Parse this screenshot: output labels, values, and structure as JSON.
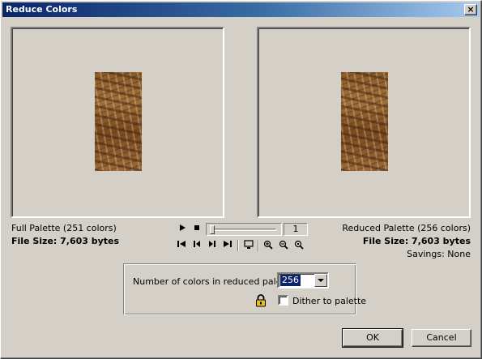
{
  "window": {
    "title": "Reduce Colors",
    "close_glyph": "×"
  },
  "left_panel": {
    "label": "Full Palette  (251 colors)",
    "file_size": "File Size:  7,603 bytes"
  },
  "right_panel": {
    "label": "Reduced Palette (256 colors)",
    "file_size": "File Size:  7,603 bytes",
    "savings": "Savings: None"
  },
  "playback": {
    "play_icon": "play-icon",
    "stop_icon": "stop-icon",
    "frame": "1",
    "slider_position": 0,
    "nav_icons": [
      "first-frame-icon",
      "prev-frame-icon",
      "next-frame-icon",
      "last-frame-icon"
    ],
    "view_icons": [
      "preview-monitor-icon",
      "zoom-in-icon",
      "zoom-out-icon",
      "zoom-actual-icon"
    ]
  },
  "options": {
    "colors_label": "Number of colors in reduced palette:",
    "colors_value": "256",
    "dither_label": "Dither to palette",
    "dither_checked": false,
    "lock_icon": "lock-icon"
  },
  "buttons": {
    "ok": "OK",
    "cancel": "Cancel"
  },
  "colors": {
    "titlebar_start": "#0a246a",
    "titlebar_end": "#a6caf0",
    "face": "#d4d0c8",
    "selection": "#0a246a"
  }
}
